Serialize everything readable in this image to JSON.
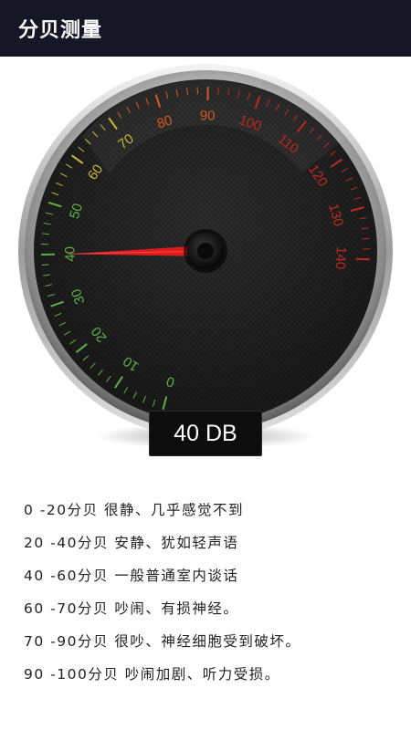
{
  "app": {
    "title": "分贝测量"
  },
  "gauge": {
    "min": 0,
    "max": 140,
    "value": 40,
    "readout": "40 DB",
    "labels": [
      "0",
      "10",
      "20",
      "30",
      "40",
      "50",
      "60",
      "70",
      "80",
      "90",
      "100",
      "110",
      "120",
      "130",
      "140"
    ],
    "colors": {
      "low": "#5fb044",
      "mid": "#c8b836",
      "high": "#d65a1e",
      "max": "#c0281e",
      "needle": "#e01b1b"
    }
  },
  "legend": {
    "rows": [
      "0 -20分贝 很静、几乎感觉不到",
      "20 -40分贝 安静、犹如轻声语",
      "40 -60分贝 一般普通室内谈话",
      "60 -70分贝 吵闹、有损神经。",
      "70 -90分贝 很吵、神经细胞受到破坏。",
      "90 -100分贝 吵闹加剧、听力受损。"
    ]
  }
}
